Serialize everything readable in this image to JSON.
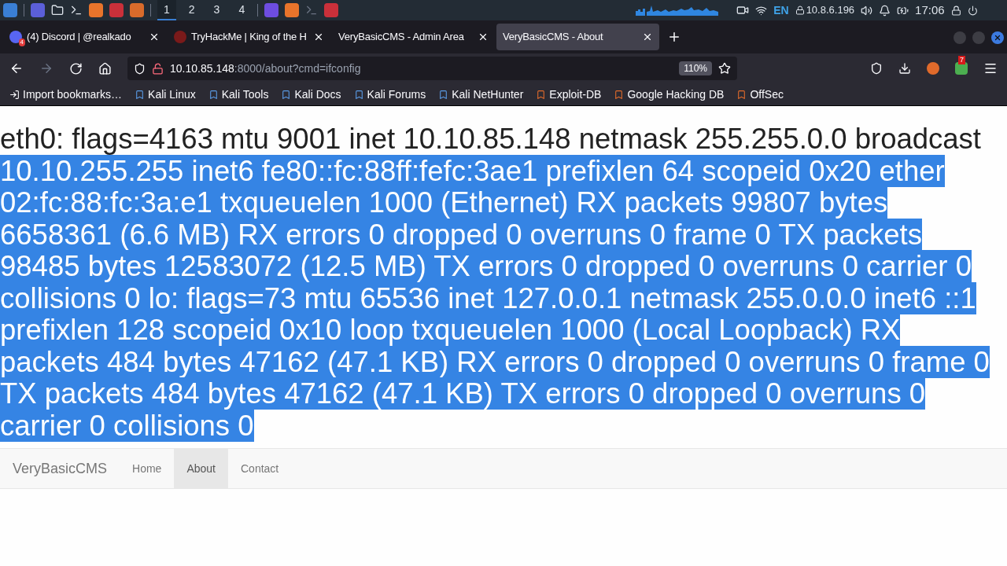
{
  "taskbar": {
    "workspaces": [
      {
        "label": "1",
        "selected": true
      },
      {
        "label": "2",
        "selected": false
      },
      {
        "label": "3",
        "selected": false
      },
      {
        "label": "4",
        "selected": false
      }
    ],
    "language": "EN",
    "vpn_ip": "10.8.6.196",
    "clock": "17:06"
  },
  "tabs": [
    {
      "title": "(4) Discord | @realkado",
      "badge": "4",
      "selected": false
    },
    {
      "title": "TryHackMe | King of the H",
      "selected": false
    },
    {
      "title": "VeryBasicCMS - Admin Area",
      "selected": false
    },
    {
      "title": "VeryBasicCMS - About",
      "selected": true
    }
  ],
  "address_bar": {
    "host": "10.10.85.148",
    "path": ":8000/about?cmd=ifconfig",
    "zoom": "110%"
  },
  "extension_badge": "7",
  "bookmarks": [
    "Import bookmarks…",
    "Kali Linux",
    "Kali Tools",
    "Kali Docs",
    "Kali Forums",
    "Kali NetHunter",
    "Exploit-DB",
    "Google Hacking DB",
    "OffSec"
  ],
  "page": {
    "output": [
      {
        "text": "eth0: flags=4163 mtu 9001 inet 10.10.85.148 netmask 255.255.0.0 broadcast ",
        "selected": false
      },
      {
        "text": "10.10.255.255 inet6 fe80::fc:88ff:fefc:3ae1 prefixlen 64 scopeid 0x20 ether 02:fc:88:fc:3a:e1 txqueuelen 1000 (Ethernet) RX packets 99807 bytes 6658361 (6.6 MB) RX errors 0 dropped 0 overruns 0 frame 0 TX packets 98485 bytes 12583072 (12.5 MB) TX errors 0 dropped 0 overruns 0 carrier 0 collisions 0 lo: flags=73 mtu 65536 inet 127.0.0.1 netmask 255.0.0.0 inet6 ::1 prefixlen 128 scopeid 0x10 loop txqueuelen 1000 (Local Loopback) RX packets 484 bytes 47162 (47.1 KB) RX errors 0 dropped 0 overruns 0 frame 0 TX packets 484 bytes 47162 (47.1 KB) TX errors 0 dropped 0 overruns 0 carrier 0 collisions 0 ",
        "selected": true
      }
    ],
    "navbar": {
      "brand": "VeryBasicCMS",
      "links": [
        {
          "label": "Home",
          "selected": false
        },
        {
          "label": "About",
          "selected": true
        },
        {
          "label": "Contact",
          "selected": false
        }
      ]
    }
  }
}
